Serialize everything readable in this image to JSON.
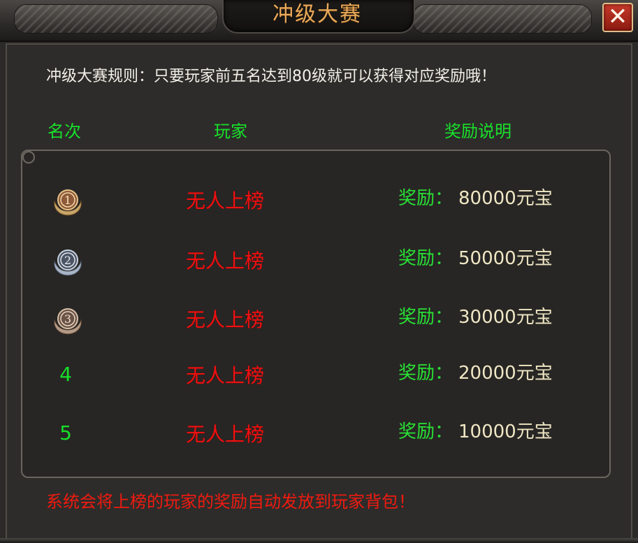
{
  "window": {
    "title": "冲级大赛",
    "close_label": "✕"
  },
  "rules_text": "冲级大赛规则：只要玩家前五名达到80级就可以获得对应奖励哦！",
  "columns": {
    "rank": "名次",
    "player": "玩家",
    "reward": "奖励说明"
  },
  "rows": [
    {
      "rank": "1",
      "medal": "gold-medal-icon",
      "player": "无人上榜",
      "reward_label": "奖励：",
      "reward_value": "80000元宝"
    },
    {
      "rank": "2",
      "medal": "silver-medal-icon",
      "player": "无人上榜",
      "reward_label": "奖励：",
      "reward_value": "50000元宝"
    },
    {
      "rank": "3",
      "medal": "bronze-medal-icon",
      "player": "无人上榜",
      "reward_label": "奖励：",
      "reward_value": "30000元宝"
    },
    {
      "rank": "4",
      "player": "无人上榜",
      "reward_label": "奖励：",
      "reward_value": "20000元宝"
    },
    {
      "rank": "5",
      "player": "无人上榜",
      "reward_label": "奖励：",
      "reward_value": "10000元宝"
    }
  ],
  "footer_note": "系统会将上榜的玩家的奖励自动发放到玩家背包！",
  "colors": {
    "title": "#e8a95a",
    "header_green": "#19e22a",
    "player_red": "#f01010",
    "reward_value": "#efe6c4",
    "close_red": "#c63a2a"
  }
}
